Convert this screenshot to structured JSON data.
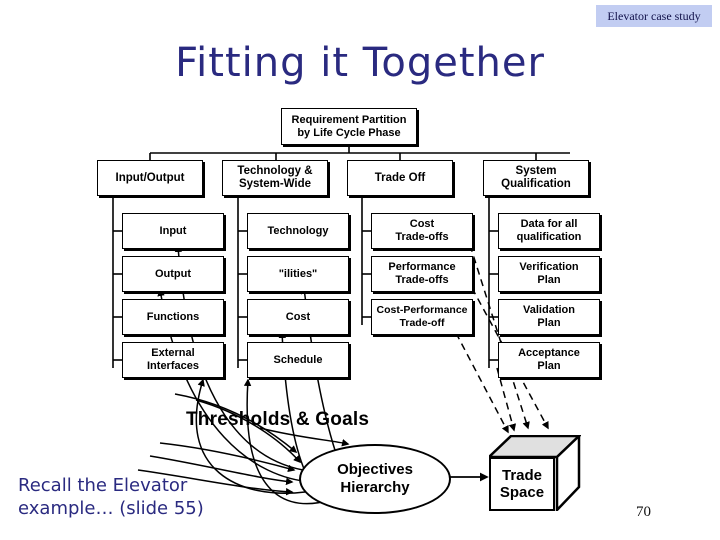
{
  "header": {
    "badge": "Elevator case study"
  },
  "title": "Fitting it Together",
  "footer": {
    "note_line1": "Recall the Elevator",
    "note_line2": "example… (slide 55)",
    "page_number": "70"
  },
  "colors": {
    "title": "#2a2a80",
    "badge_bg": "#c2cdf2",
    "node_border": "#000000",
    "node_fill": "#ffffff",
    "cube_top": "#e0e0e0"
  },
  "diagram": {
    "root": {
      "line1": "Requirement Partition",
      "line2": "by Life Cycle Phase"
    },
    "categories": [
      {
        "line1": "Input/Output",
        "line2": ""
      },
      {
        "line1": "Technology &",
        "line2": "System-Wide"
      },
      {
        "line1": "Trade Off",
        "line2": ""
      },
      {
        "line1": "System",
        "line2": "Qualification"
      }
    ],
    "columns": [
      {
        "category": "Input/Output",
        "leaves": [
          {
            "line1": "Input",
            "line2": ""
          },
          {
            "line1": "Output",
            "line2": ""
          },
          {
            "line1": "Functions",
            "line2": ""
          },
          {
            "line1": "External",
            "line2": "Interfaces"
          }
        ]
      },
      {
        "category": "Technology & System-Wide",
        "leaves": [
          {
            "line1": "Technology",
            "line2": ""
          },
          {
            "line1": "\"ilities\"",
            "line2": ""
          },
          {
            "line1": "Cost",
            "line2": ""
          },
          {
            "line1": "Schedule",
            "line2": ""
          }
        ]
      },
      {
        "category": "Trade Off",
        "leaves": [
          {
            "line1": "Cost",
            "line2": "Trade-offs"
          },
          {
            "line1": "Performance",
            "line2": "Trade-offs"
          },
          {
            "line1": "Cost-Performance",
            "line2": "Trade-off"
          }
        ]
      },
      {
        "category": "System Qualification",
        "leaves": [
          {
            "line1": "Data for all",
            "line2": "qualification"
          },
          {
            "line1": "Verification",
            "line2": "Plan"
          },
          {
            "line1": "Validation",
            "line2": "Plan"
          },
          {
            "line1": "Acceptance",
            "line2": "Plan"
          }
        ]
      }
    ],
    "thresholds_label": "Thresholds & Goals",
    "objectives": {
      "line1": "Objectives",
      "line2": "Hierarchy"
    },
    "trade_space": {
      "line1": "Trade",
      "line2": "Space"
    }
  }
}
